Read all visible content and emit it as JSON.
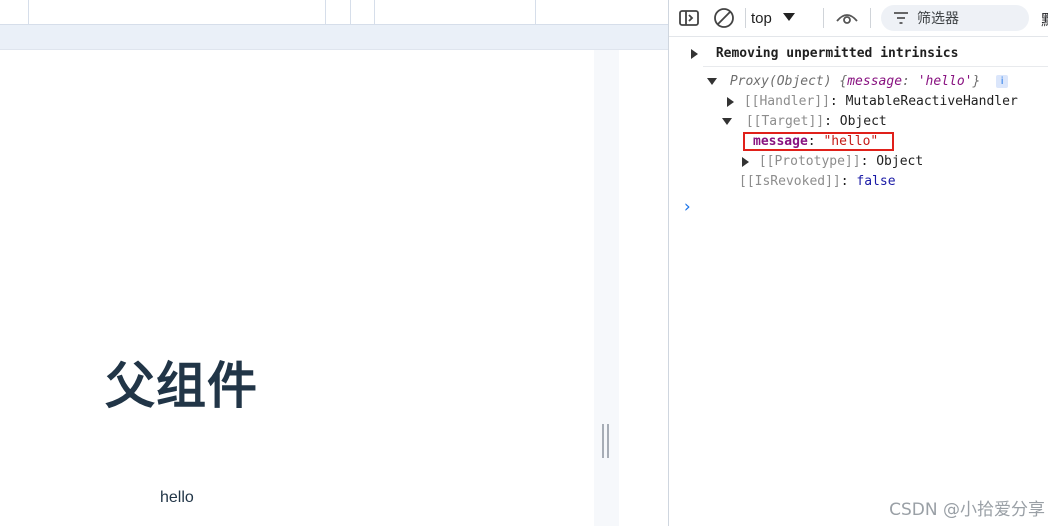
{
  "page": {
    "heading": "父组件",
    "child_text": "hello"
  },
  "devtools": {
    "toolbar": {
      "context": "top",
      "filter_placeholder": "筛选器",
      "overflow_glyph": "默"
    },
    "console": {
      "group_title": "Removing unpermitted intrinsics",
      "proxy_label": "Proxy(Object) ",
      "proxy_preview_open": "{",
      "proxy_preview_key": "message",
      "proxy_preview_sep": ": ",
      "proxy_preview_value": "'hello'",
      "proxy_preview_close": "}",
      "info_badge": "i",
      "handler_key": "[[Handler]]",
      "handler_value": "MutableReactiveHandler",
      "target_key": "[[Target]]",
      "target_value": "Object",
      "message_key": "message",
      "message_value": "\"hello\"",
      "prototype_key": "[[Prototype]]",
      "prototype_value": "Object",
      "revoked_key": "[[IsRevoked]]",
      "revoked_value": "false",
      "colon": ": ",
      "prompt": "›"
    }
  },
  "watermark": "CSDN @小拾爱分享",
  "colors": {
    "heading": "#213547",
    "highlight_border": "#e0201a",
    "prompt": "#1a73e8"
  }
}
